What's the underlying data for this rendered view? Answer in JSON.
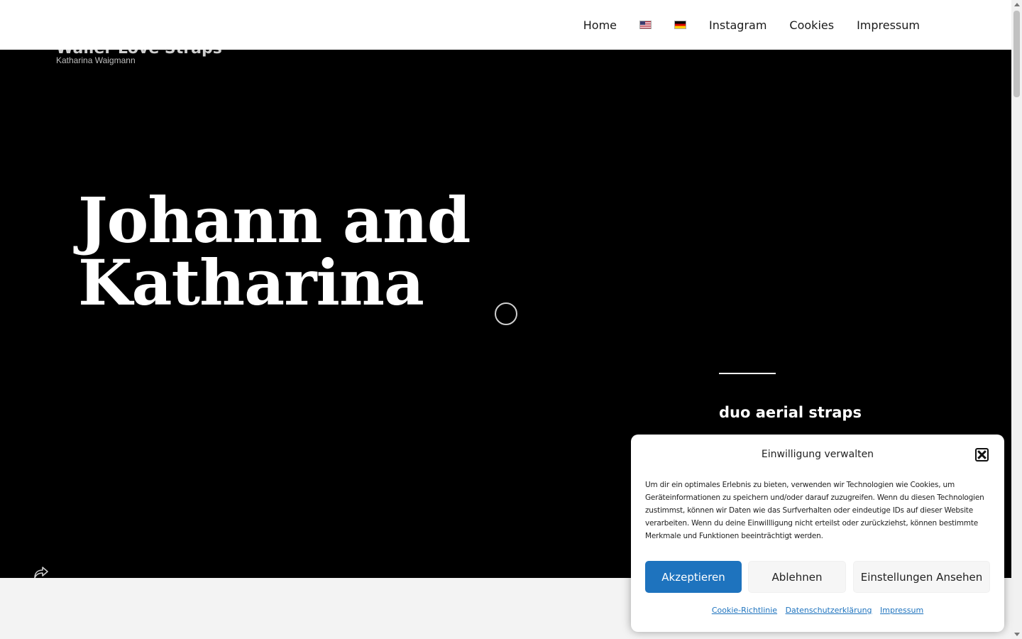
{
  "nav": {
    "items": [
      "Home",
      "Instagram",
      "Cookies",
      "Impressum"
    ],
    "flags": [
      "us-flag-icon",
      "de-flag-icon"
    ]
  },
  "site": {
    "title": "Waller Love Straps",
    "tagline": "Katharina Waigmann"
  },
  "hero": {
    "title_line1": "Johann and",
    "title_line2": "Katharina",
    "subheading": "duo aerial straps",
    "share_icon": "share-icon",
    "loading_icon": "spinner-icon"
  },
  "consent": {
    "title": "Einwilligung verwalten",
    "body": "Um dir ein optimales Erlebnis zu bieten, verwenden wir Technologien wie Cookies, um Geräteinformationen zu speichern und/oder darauf zuzugreifen. Wenn du diesen Technologien zustimmst, können wir Daten wie das Surfverhalten oder eindeutige IDs auf dieser Website verarbeiten. Wenn du deine Einwillligung nicht erteilst oder zurückziehst, können bestimmte Merkmale und Funktionen beeinträchtigt werden.",
    "accept": "Akzeptieren",
    "deny": "Ablehnen",
    "preferences": "Einstellungen Ansehen",
    "links": [
      "Cookie-Richtlinie",
      "Datenschutzerklärung",
      "Impressum"
    ],
    "close_icon": "close-icon"
  },
  "colors": {
    "accent": "#1e73be",
    "hero_bg": "#000000"
  }
}
